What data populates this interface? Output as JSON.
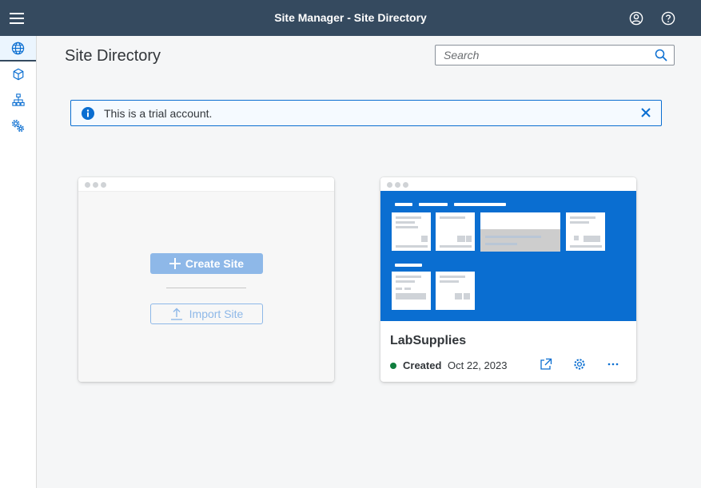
{
  "shell": {
    "title": "Site Manager - Site Directory",
    "icons": {
      "menu": "hamburger-icon",
      "user": "user-icon",
      "help": "help-icon"
    },
    "bg_color": "#354a5f"
  },
  "sidenav": {
    "items": [
      {
        "icon": "globe-icon",
        "selected": true
      },
      {
        "icon": "cube-icon",
        "selected": false
      },
      {
        "icon": "hierarchy-icon",
        "selected": false
      },
      {
        "icon": "gears-icon",
        "selected": false
      }
    ]
  },
  "page": {
    "title": "Site Directory"
  },
  "search": {
    "placeholder": "Search",
    "value": "",
    "icon": "search-icon"
  },
  "message_strip": {
    "text": "This is a trial account.",
    "type": "information",
    "accent_color": "#0a6ed1"
  },
  "new_site_card": {
    "create_label": "Create Site",
    "import_label": "Import Site"
  },
  "sites": [
    {
      "name": "LabSupplies",
      "status": "Created",
      "status_color": "#107e3e",
      "date": "Oct 22, 2023",
      "preview_color": "#0a6ed1",
      "actions": [
        "launch-icon",
        "settings-icon",
        "overflow-icon"
      ]
    }
  ]
}
